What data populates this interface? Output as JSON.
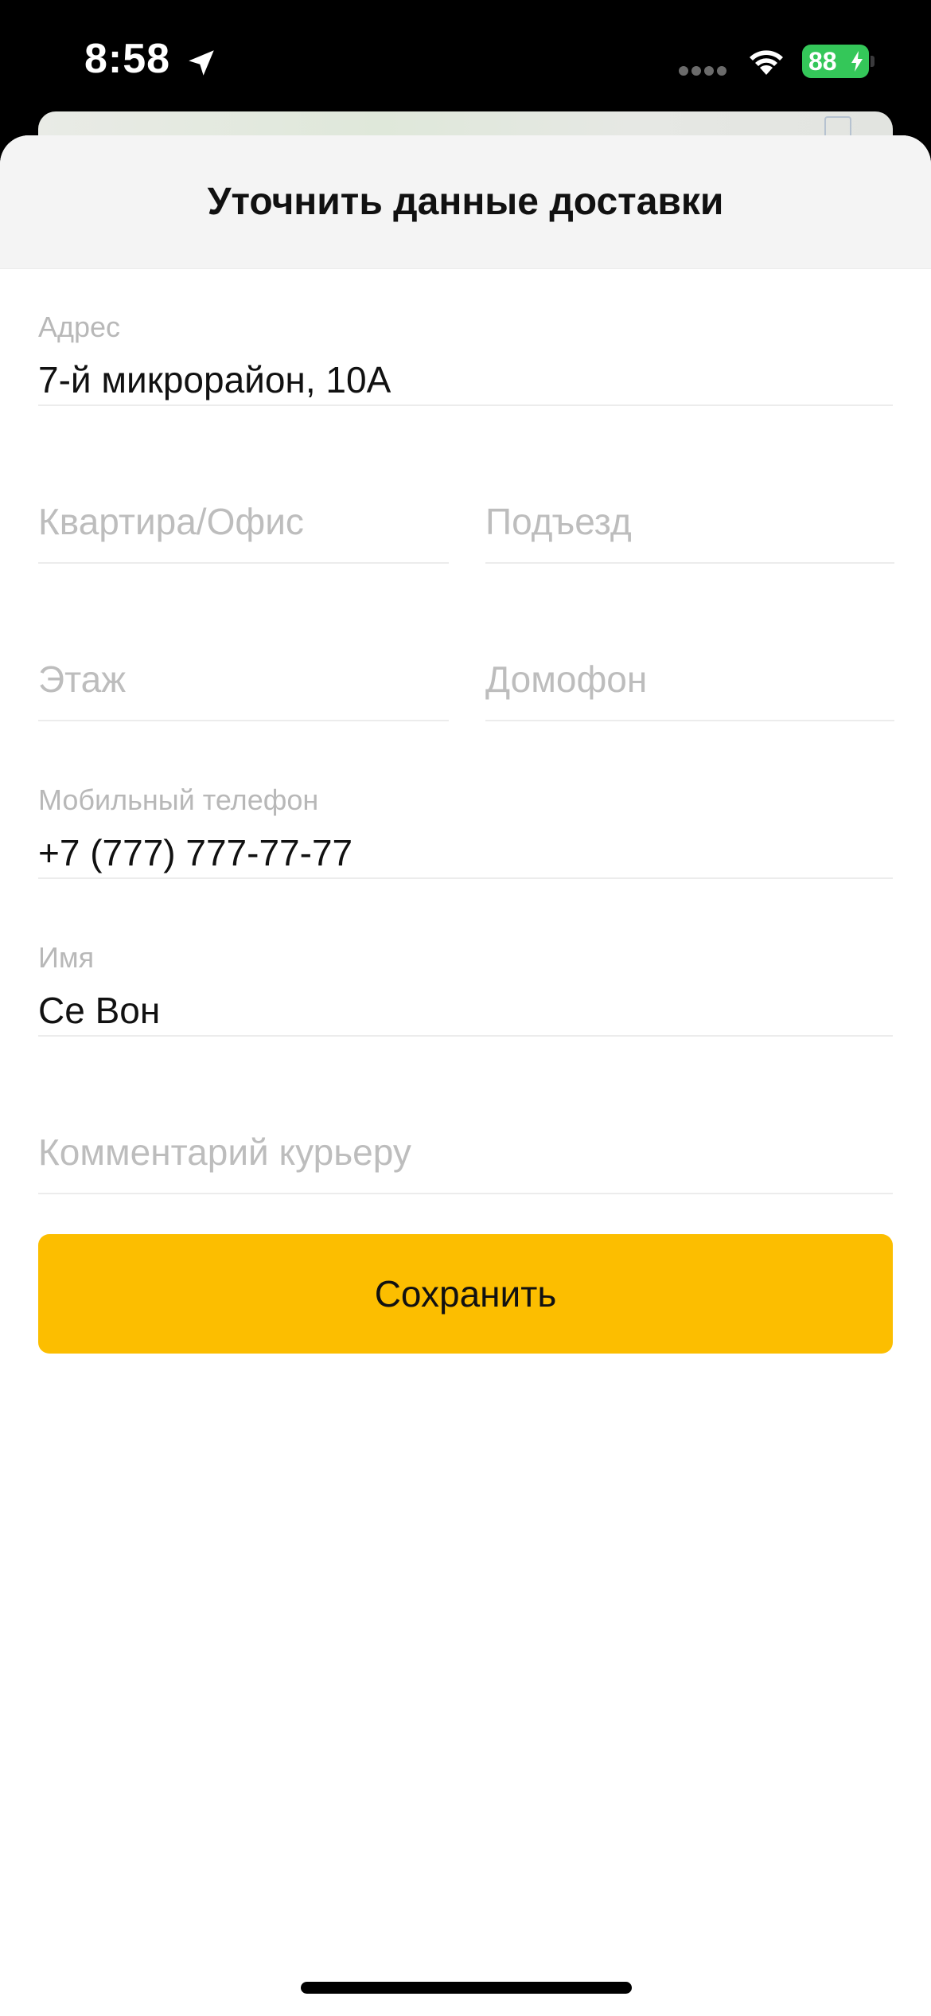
{
  "status_bar": {
    "time": "8:58",
    "battery_level": "88",
    "battery_color": "#34c759"
  },
  "sheet": {
    "title": "Уточнить данные доставки"
  },
  "form": {
    "address": {
      "label": "Адрес",
      "value": "7-й микрорайон, 10А"
    },
    "apartment": {
      "placeholder": "Квартира/Офис"
    },
    "entrance": {
      "placeholder": "Подъезд"
    },
    "floor": {
      "placeholder": "Этаж"
    },
    "intercom": {
      "placeholder": "Домофон"
    },
    "phone": {
      "label": "Мобильный телефон",
      "value": "+7 (777) 777-77-77"
    },
    "name": {
      "label": "Имя",
      "value": "Се Вон"
    },
    "comment": {
      "placeholder": "Комментарий курьеру"
    }
  },
  "save_button": {
    "label": "Сохранить",
    "color": "#fcbe00"
  },
  "icons": {
    "location": "location-arrow-icon",
    "signal": "cellular-signal-icon",
    "wifi": "wifi-icon",
    "battery": "battery-charging-icon"
  }
}
